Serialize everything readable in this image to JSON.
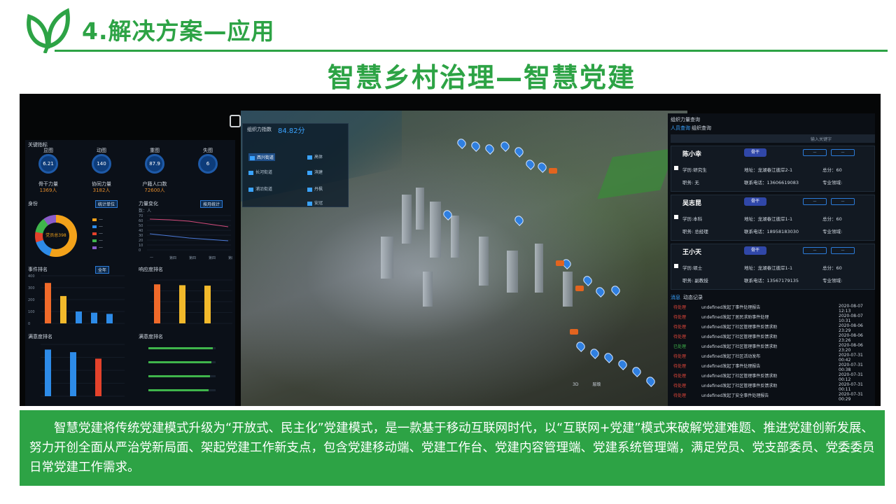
{
  "slide": {
    "section_title": "4.解决方案—应用",
    "subtitle": "智慧乡村治理—智慧党建",
    "caption": "智慧党建将传统党建模式升级为“开放式、民主化”党建模式，是一款基于移动互联网时代，以“互联网+党建”模式来破解党建难题、推进党建创新发展、努力开创全面从严治党新局面、架起党建工作新支点，包含党建移动端、党建工作台、党建内容管理端、党建系统管理端，满足党员、党支部委员、党委委员日常党建工作需求。",
    "brand_color": "#2da345"
  },
  "dashboard": {
    "left": {
      "key_indicators_title": "关键指标",
      "kpis": [
        {
          "label": "显图",
          "value": "6.21",
          "sub_label": "骨干力量",
          "sub_value": "1369人"
        },
        {
          "label": "动图",
          "value": "140",
          "sub_label": "协同力量",
          "sub_value": "3182人"
        },
        {
          "label": "重图",
          "value": "87.9",
          "sub_label": "户籍人口数",
          "sub_value": "72600人"
        },
        {
          "label": "失图",
          "value": "6",
          "sub_label": "",
          "sub_value": ""
        }
      ],
      "identity_title": "身份",
      "donut_center": "党员总398",
      "force_change_title": "力量变化",
      "force_y_label": "数：人",
      "force_y_ticks": [
        "70",
        "60",
        "50",
        "40",
        "30",
        "20",
        "10",
        "0"
      ],
      "force_x_ticks": [
        "一",
        "第四",
        "第四",
        "第四",
        "第四"
      ],
      "event_rank_title": "事件排名",
      "event_y_ticks": [
        "400",
        "300",
        "200",
        "100",
        "0"
      ],
      "event_bars": [
        340,
        230,
        100,
        90,
        80
      ],
      "response_rank_title": "响应度排名",
      "response_bars": [
        90,
        88,
        87
      ],
      "satisfaction_title": "满意度排名",
      "complaint_title": "满意度排名",
      "complaint_bars": [
        180,
        170,
        145
      ],
      "tags": [
        "统计单位",
        "按月统计",
        "全年"
      ]
    },
    "district": {
      "title": "组织力指数",
      "value": "84.82分",
      "items": [
        "西兴街道",
        "长河街道",
        "浦沿街道",
        "高体",
        "滨建",
        "丹枫",
        "安冠"
      ]
    },
    "right": {
      "title": "组织力量查询",
      "tabs": [
        "人员查询",
        "组织查询"
      ],
      "search_placeholder": "输入关键字",
      "people": [
        {
          "name": "陈小幸",
          "badge": "骨干",
          "edu": "学历:研究生",
          "job": "职务: 无",
          "addr": "地址：龙湖春江彼岸2-1",
          "phone": "联系电话：13606619083",
          "score": "总分：60",
          "field": "专业领域:"
        },
        {
          "name": "吴志昆",
          "badge": "骨干",
          "edu": "学历:本科",
          "job": "职务: 总经理",
          "addr": "地址：龙湖春江彼岸1-1",
          "phone": "联系电话：18958183030",
          "score": "总分：60",
          "field": "专业领域:"
        },
        {
          "name": "王小天",
          "badge": "骨干",
          "edu": "学历:硕士",
          "job": "职务: 副教授",
          "addr": "地址：龙湖春江彼岸1-1",
          "phone": "联系电话：13567179135",
          "score": "总分：60",
          "field": "专业领域:"
        }
      ],
      "log_tabs": [
        "消息",
        "动态记录"
      ],
      "logs": [
        {
          "status": "待处理",
          "text": "undefined发起了事件处理报告",
          "date": "2020-08-07 12:13"
        },
        {
          "status": "待处理",
          "text": "undefined发起了居民求助事件处理",
          "date": "2020-08-07 10:31"
        },
        {
          "status": "待处理",
          "text": "undefined发起了社区管理事件反馈求助",
          "date": "2020-08-06 23:29"
        },
        {
          "status": "待处理",
          "text": "undefined发起了社区管理事件反馈求助",
          "date": "2020-08-06 23:26"
        },
        {
          "status": "已处理",
          "text": "undefined发起了社区管理事件反馈求助",
          "date": "2020-08-06 23:20"
        },
        {
          "status": "待处理",
          "text": "undefined发起了社区活动发布",
          "date": "2020-07-31 00:42"
        },
        {
          "status": "待处理",
          "text": "undefined发起了事件处理报告",
          "date": "2020-07-31 00:38"
        },
        {
          "status": "待处理",
          "text": "undefined发起了社区管理事件反馈求助",
          "date": "2020-07-31 00:12"
        },
        {
          "status": "待处理",
          "text": "undefined发起了社区管理事件反馈求助",
          "date": "2020-07-31 00:11"
        },
        {
          "status": "待处理",
          "text": "undefined发起了安全事件处理报告",
          "date": "2020-07-31 00:29"
        }
      ]
    },
    "map": {
      "scale_labels": [
        "3D",
        "层级"
      ]
    }
  }
}
